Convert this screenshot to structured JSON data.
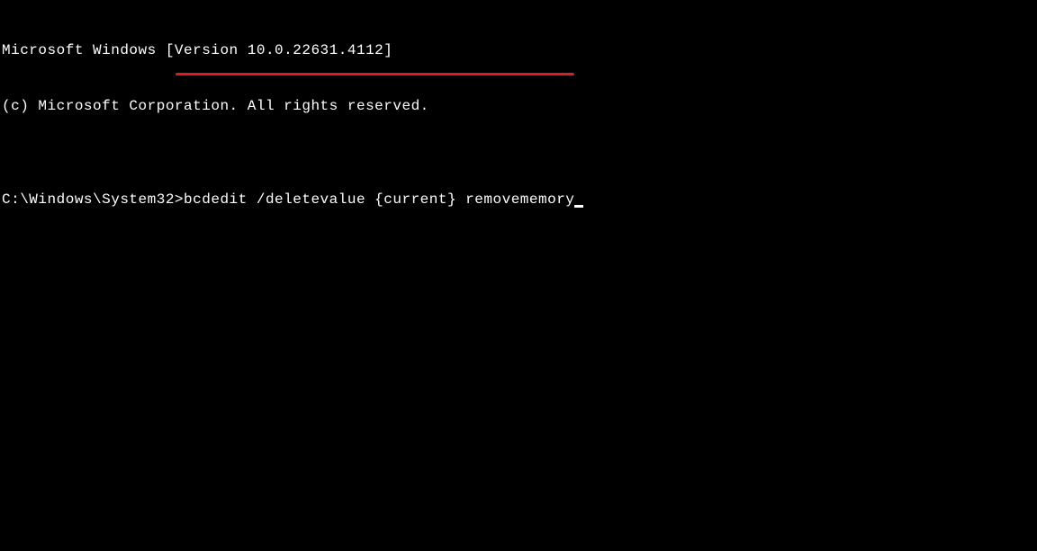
{
  "terminal": {
    "banner_line1": "Microsoft Windows [Version 10.0.22631.4112]",
    "banner_line2": "(c) Microsoft Corporation. All rights reserved.",
    "blank_line": "",
    "prompt": "C:\\Windows\\System32>",
    "command": "bcdedit /deletevalue {current} removememory"
  },
  "annotation": {
    "underline_color": "#e01b24"
  }
}
